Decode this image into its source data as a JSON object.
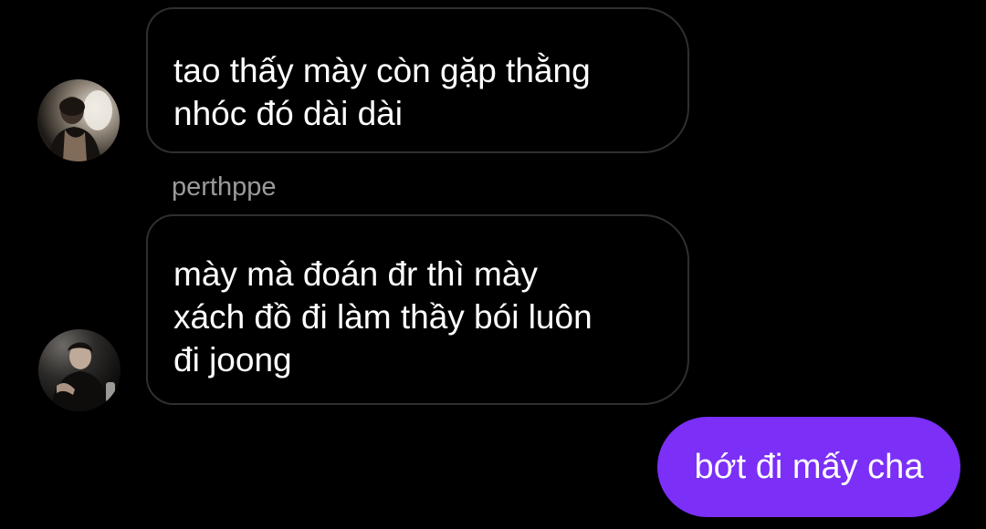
{
  "messages": [
    {
      "direction": "incoming",
      "avatar": "user-avatar-photo",
      "lines": [
        "tao thấy mày còn gặp thằng",
        "nhóc đó dài dài"
      ]
    },
    {
      "direction": "incoming",
      "sender": "perthppe",
      "avatar": "user-avatar-photo",
      "lines": [
        "mày mà đoán đr thì mày",
        "xách đồ đi làm thầy bói luôn",
        "đi joong"
      ]
    },
    {
      "direction": "outgoing",
      "text": "bớt đi mấy cha"
    }
  ],
  "colors": {
    "background": "#000000",
    "incoming_bubble_border": "#2f2f2f",
    "outgoing_bubble": "#7b2ff7",
    "sender_name": "#9a9a9a"
  }
}
